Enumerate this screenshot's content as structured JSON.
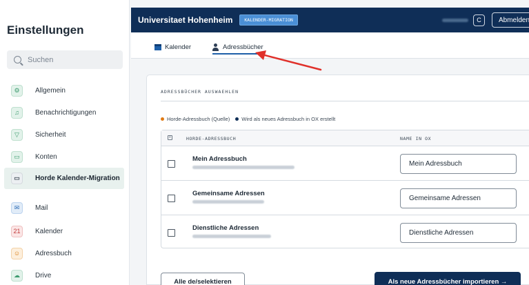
{
  "sidebar": {
    "title": "Einstellungen",
    "search_placeholder": "Suchen",
    "items": [
      {
        "label": "Allgemein",
        "icon": "gear-icon"
      },
      {
        "label": "Benachrichtigungen",
        "icon": "bell-icon"
      },
      {
        "label": "Sicherheit",
        "icon": "shield-icon"
      },
      {
        "label": "Konten",
        "icon": "accounts-icon"
      },
      {
        "label": "Horde Kalender-Migration",
        "icon": "folder-icon",
        "active": true
      },
      {
        "label": "Mail",
        "icon": "mail-icon"
      },
      {
        "label": "Kalender",
        "icon": "calendar-icon",
        "icon_text": "21"
      },
      {
        "label": "Adressbuch",
        "icon": "addressbook-icon"
      },
      {
        "label": "Drive",
        "icon": "cloud-icon"
      }
    ]
  },
  "header": {
    "title": "Universitaet Hohenheim",
    "badge": "KALENDER-MIGRATION",
    "user_initial": "C",
    "logout": "Abmelden"
  },
  "tabs": [
    {
      "label": "Kalender",
      "icon": "calendar-icon"
    },
    {
      "label": "Adressbücher",
      "icon": "person-icon",
      "active": true
    }
  ],
  "panel": {
    "heading": "ADRESSBÜCHER AUSWAEHLEN",
    "legend_source": "Horde-Adressbuch (Quelle)",
    "legend_target": "Wird als neues Adressbuch in OX erstellt",
    "col_horde": "HORDE-ADRESSBUCH",
    "col_name": "NAME IN OX",
    "rows": [
      {
        "name": "Mein Adressbuch",
        "ox_name": "Mein Adressbuch"
      },
      {
        "name": "Gemeinsame Adressen",
        "ox_name": "Gemeinsame Adressen"
      },
      {
        "name": "Dienstliche Adressen",
        "ox_name": "Dienstliche Adressen"
      }
    ],
    "toggle_all": "Alle de/selektieren",
    "import": "Als neue Adressbücher importieren →"
  },
  "colors": {
    "header_bg": "#0f2e57",
    "accent": "#1d5fa8",
    "source_dot": "#e07a13",
    "arrow": "#e0302a"
  }
}
